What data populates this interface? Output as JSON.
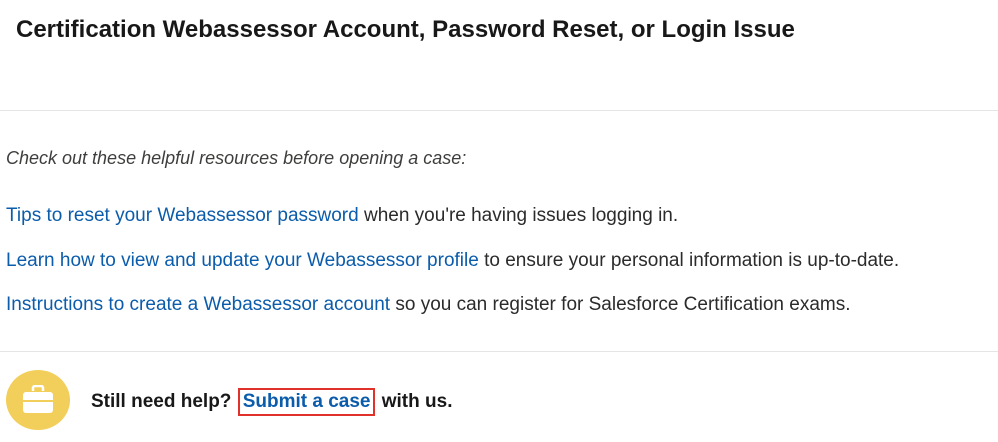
{
  "page": {
    "title": "Certification Webassessor Account, Password Reset, or Login Issue"
  },
  "resources": {
    "intro": "Check out these helpful resources before opening a case:",
    "items": [
      {
        "link_text": "Tips to reset your Webassessor password",
        "suffix": " when you're having issues logging in."
      },
      {
        "link_text": "Learn how to view and update your Webassessor profile",
        "suffix": " to ensure your personal information is up-to-date."
      },
      {
        "link_text": "Instructions to create a Webassessor account",
        "suffix": " so you can register for Salesforce Certification exams."
      }
    ]
  },
  "help": {
    "icon": "briefcase-icon",
    "prefix": "Still need help? ",
    "link_text": "Submit a case",
    "suffix": " with us."
  },
  "colors": {
    "link": "#0b5cab",
    "icon_background": "#f2cf5b",
    "highlight_border": "#e0322b",
    "divider": "#e5e5e5"
  }
}
